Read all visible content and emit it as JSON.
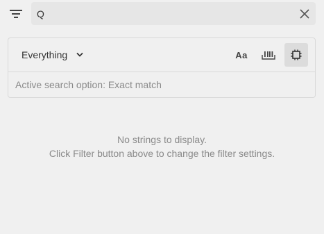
{
  "search": {
    "value": "Q",
    "clear_icon": "close-icon",
    "filter_icon": "filter-icon"
  },
  "options": {
    "scope_selected": "Everything",
    "buttons": [
      {
        "name": "match-case",
        "label": "Aa",
        "active": false
      },
      {
        "name": "whole-word",
        "icon": "whole-word-icon",
        "active": false
      },
      {
        "name": "exact-match",
        "icon": "exact-match-icon",
        "active": true
      }
    ],
    "status_text": "Active search option: Exact match"
  },
  "empty_state": {
    "line1": "No strings to display.",
    "line2": "Click Filter button above to change the filter settings."
  },
  "colors": {
    "background": "#f0f0f0",
    "search_bg": "#e6e6e6",
    "active_button_bg": "#dcdcdc",
    "muted_text": "#8a8a8a"
  }
}
